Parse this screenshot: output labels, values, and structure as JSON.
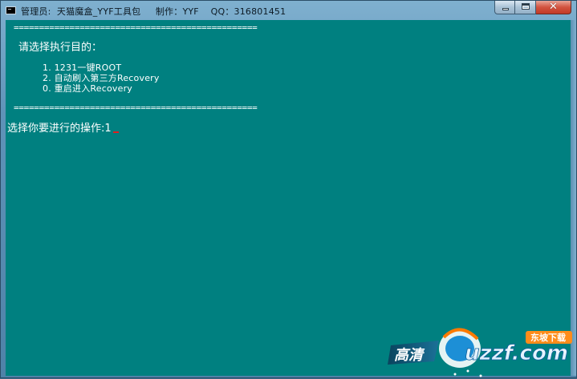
{
  "window": {
    "title": "管理员:  天猫魔盒_YYF工具包     制作：YYF    QQ：316801451",
    "app_icon": "console-icon"
  },
  "caption_buttons": {
    "minimize": "minimize-icon",
    "maximize": "maximize-icon",
    "close_glyph": "✕"
  },
  "console": {
    "separator": "================================================",
    "prompt_title": "请选择执行目的：",
    "menu": [
      "1. 1231一键ROOT",
      "2. 自动刷入第三方Recovery",
      "0. 重启进入Recovery"
    ],
    "input_prompt": "选择你要进行的操作:",
    "input_value": "1"
  },
  "watermark": {
    "left_text": "高清",
    "brand_text": "uzzf.com",
    "badge_text": "东坡下载"
  }
}
